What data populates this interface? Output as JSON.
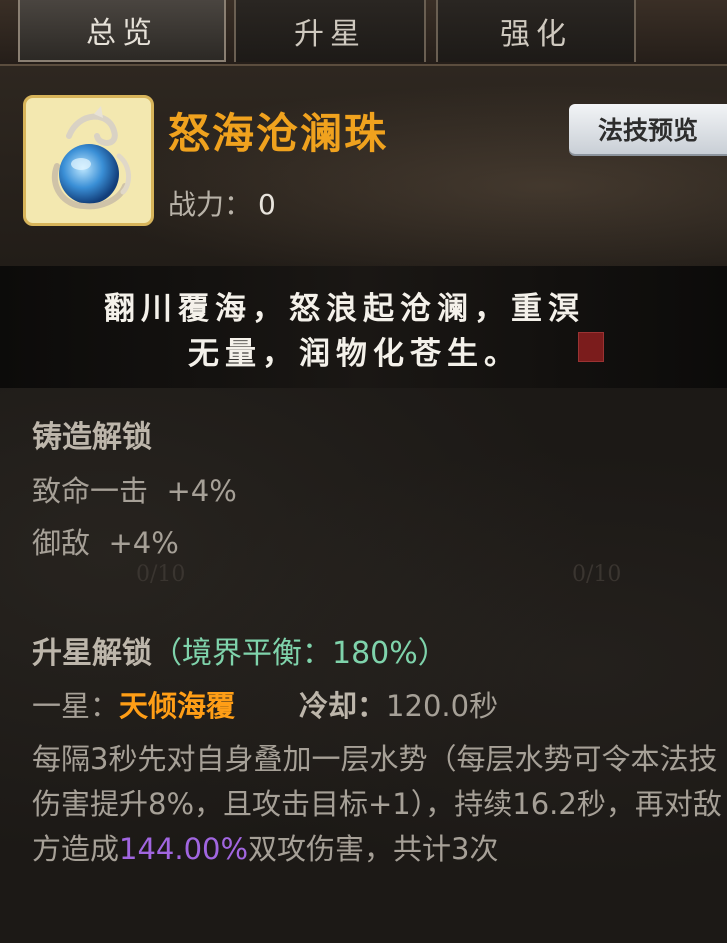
{
  "tabs": [
    {
      "label": "总览",
      "active": true
    },
    {
      "label": "升星",
      "active": false
    },
    {
      "label": "强化",
      "active": false
    }
  ],
  "item": {
    "name": "怒海沧澜珠",
    "power_label": "战力：",
    "power_value": "0",
    "icon": "blue-dragon-pearl-icon",
    "preview_button": "法技预览"
  },
  "quote": {
    "line1": "翻川覆海，怒浪起沧澜，重溟",
    "line2": "无量，润物化苍生。"
  },
  "forge": {
    "title": "铸造解锁",
    "stats": [
      {
        "name": "致命一击",
        "value": "+4%"
      },
      {
        "name": "御敌",
        "value": "+4%"
      }
    ]
  },
  "ghost_counters": [
    "0/10",
    "0/10"
  ],
  "star": {
    "title": "升星解锁",
    "realm": "（境界平衡：180%）",
    "level_label": "一星：",
    "skill_name": "天倾海覆",
    "cooldown_label": "冷却：",
    "cooldown_value": "120.0秒",
    "desc_part1": "每隔3秒先对自身叠加一层水势（每层水势可令本法技伤害提升8%，且攻击目标+1），持续16.2秒，再对敌方造成",
    "desc_highlight": "144.00%",
    "desc_part2": "双攻伤害，共计3次"
  },
  "colors": {
    "name_gold": "#f0a21e",
    "realm_green": "#7fd3ab",
    "skill_orange": "#ff9e16",
    "highlight_purple": "#a166e0"
  }
}
